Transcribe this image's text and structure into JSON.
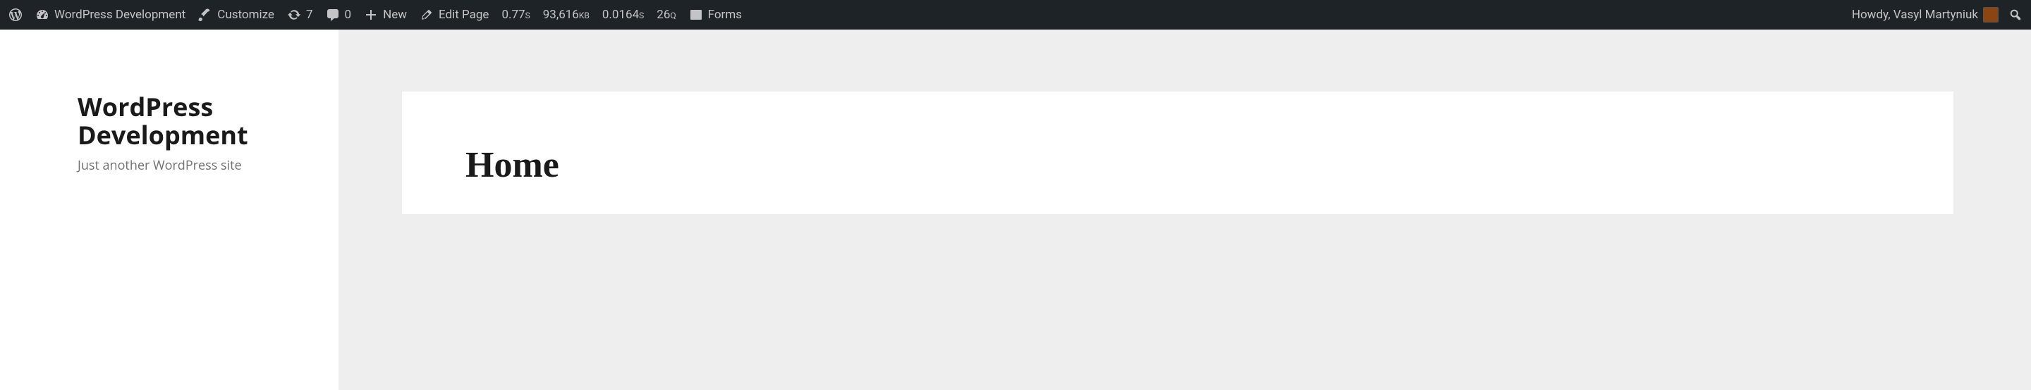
{
  "adminBar": {
    "siteName": "WordPress Development",
    "customize": "Customize",
    "updatesCount": "7",
    "commentsCount": "0",
    "newLabel": "New",
    "editPage": "Edit Page",
    "stats": {
      "time1": "0.77",
      "time1Unit": "S",
      "memory": "93,616",
      "memoryUnit": "KB",
      "time2": "0.0164",
      "time2Unit": "S",
      "queries": "26",
      "queriesUnit": "Q"
    },
    "forms": "Forms",
    "greeting": "Howdy, Vasyl Martyniuk"
  },
  "sidebar": {
    "siteTitle": "WordPress Development",
    "tagline": "Just another WordPress site"
  },
  "page": {
    "title": "Home"
  }
}
